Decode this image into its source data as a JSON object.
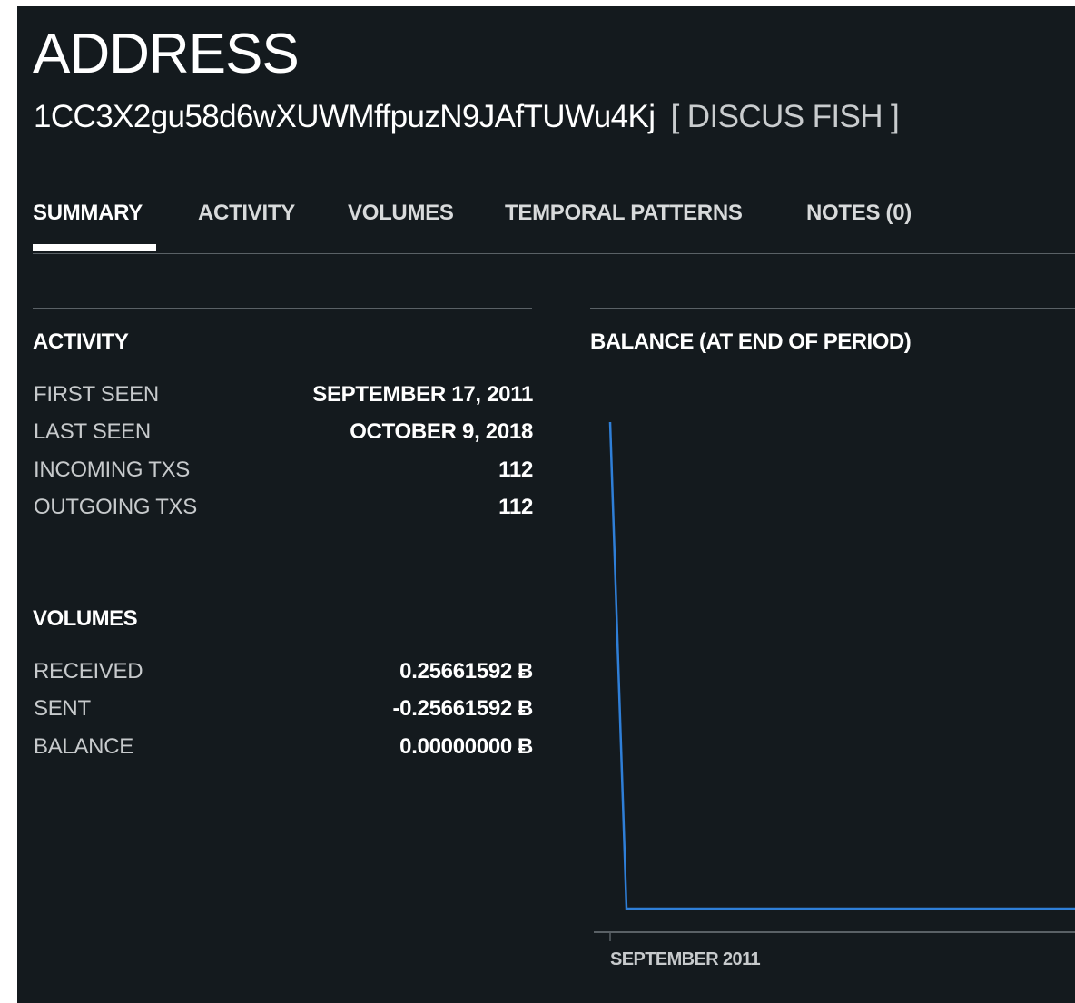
{
  "page": {
    "title": "ADDRESS",
    "address": "1CC3X2gu58d6wXUWMffpuzN9JAfTUWu4Kj",
    "tag": "[ DISCUS FISH ]"
  },
  "tabs": [
    {
      "label": "SUMMARY",
      "active": true
    },
    {
      "label": "ACTIVITY",
      "active": false
    },
    {
      "label": "VOLUMES",
      "active": false
    },
    {
      "label": "TEMPORAL PATTERNS",
      "active": false
    },
    {
      "label": "NOTES (0)",
      "active": false
    }
  ],
  "activity": {
    "title": "ACTIVITY",
    "rows": [
      {
        "label": "FIRST SEEN",
        "value": "SEPTEMBER 17, 2011"
      },
      {
        "label": "LAST SEEN",
        "value": "OCTOBER 9, 2018"
      },
      {
        "label": "INCOMING TXS",
        "value": "112"
      },
      {
        "label": "OUTGOING TXS",
        "value": "112"
      }
    ]
  },
  "volumes": {
    "title": "VOLUMES",
    "currency_symbol": "Ƀ",
    "rows": [
      {
        "label": "RECEIVED",
        "value": "0.25661592"
      },
      {
        "label": "SENT",
        "value": "-0.25661592"
      },
      {
        "label": "BALANCE",
        "value": "0.00000000"
      }
    ]
  },
  "chart_data": {
    "type": "line",
    "title": "BALANCE (AT END OF PERIOD)",
    "xlabel": "",
    "ylabel": "",
    "x_tick_labels": [
      "SEPTEMBER 2011"
    ],
    "x": [
      "2011-09",
      "2011-10",
      "2018-10"
    ],
    "series": [
      {
        "values": [
          0.25661592,
          0,
          0
        ]
      }
    ],
    "ylim": [
      0,
      0.25661592
    ],
    "grid": false,
    "line_color": "#2f7fd8",
    "axis_color": "#5a6166"
  },
  "colors": {
    "background": "#141a1e",
    "text": "#ffffff",
    "muted_text": "#c7cacc",
    "accent_line": "#2f7fd8"
  }
}
